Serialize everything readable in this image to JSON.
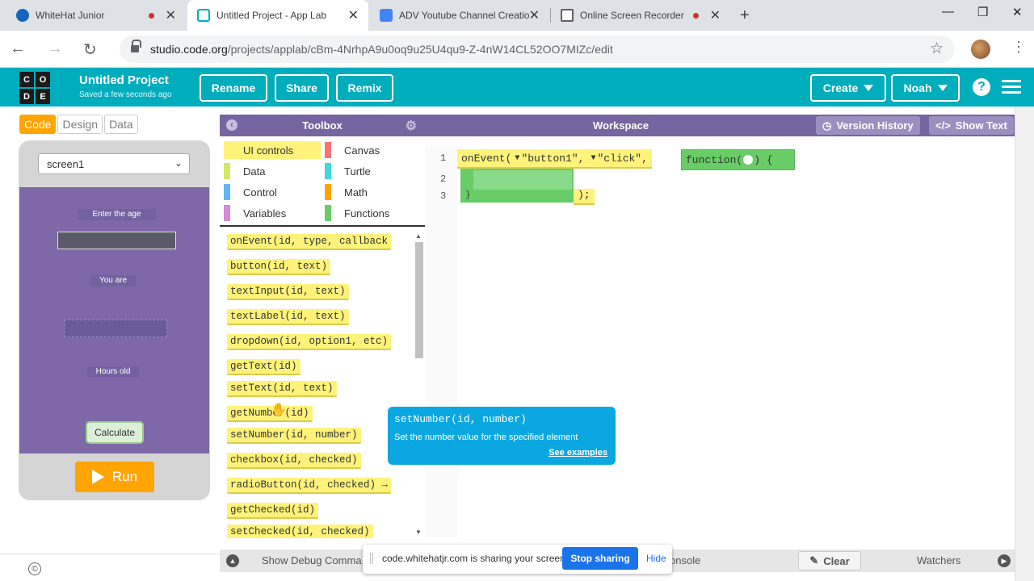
{
  "browser": {
    "tabs": [
      {
        "title": "WhiteHat Junior",
        "recording": true,
        "favicon_color": "#1565c0"
      },
      {
        "title": "Untitled Project - App Lab",
        "recording": false,
        "favicon_color": "#00adbc"
      },
      {
        "title": "ADV Youtube Channel Creatio",
        "recording": false,
        "favicon_color": "#4285f4"
      },
      {
        "title": "Online Screen Recorder",
        "recording": true,
        "favicon_color": "#5f6368"
      }
    ],
    "url_host": "studio.code.org",
    "url_path": "/projects/applab/cBm-4NrhpA9u0oq9u25U4qu9-Z-4nW14CL52OO7MIZc/edit"
  },
  "header": {
    "logo_letters": [
      "C",
      "O",
      "D",
      "E"
    ],
    "project_name": "Untitled Project",
    "save_status": "Saved a few seconds ago",
    "rename": "Rename",
    "share": "Share",
    "remix": "Remix",
    "create": "Create",
    "user": "Noah",
    "help": "?"
  },
  "left": {
    "tabs": {
      "code": "Code",
      "design": "Design",
      "data": "Data"
    },
    "screen_select": "screen1",
    "app": {
      "label_enter_age": "Enter the age",
      "label_you_are": "You are",
      "label_hours_old": "Hours old",
      "calculate": "Calculate"
    },
    "run": "Run",
    "copyright_symbol": "©"
  },
  "toolbox": {
    "title": "Toolbox",
    "categories": [
      {
        "label": "UI controls",
        "color": "#fff27a"
      },
      {
        "label": "Canvas",
        "color": "#f7736f"
      },
      {
        "label": "Data",
        "color": "#d3e965"
      },
      {
        "label": "Turtle",
        "color": "#3fd8dc"
      },
      {
        "label": "Control",
        "color": "#64b5f6"
      },
      {
        "label": "Math",
        "color": "#ffa400"
      },
      {
        "label": "Variables",
        "color": "#d28cd6"
      },
      {
        "label": "Functions",
        "color": "#68cd67"
      }
    ],
    "blocks": [
      "onEvent(id, type, callback",
      "button(id, text)",
      "textInput(id, text)",
      "textLabel(id, text)",
      "dropdown(id, option1, etc)",
      "getText(id)",
      "setText(id, text)",
      "getNumber(id)",
      "setNumber(id, number)",
      "checkbox(id, checked)",
      "radioButton(id, checked) →",
      "getChecked(id)",
      "setChecked(id, checked)"
    ]
  },
  "workspace": {
    "title": "Workspace",
    "version_history": "Version History",
    "show_text": "Show Text",
    "line_numbers": [
      "1",
      "2",
      "3"
    ],
    "code_event": "onEvent(",
    "arg_id": "\"button1\"",
    "arg_type": "\"click\"",
    "comma": ",",
    "fn_keyword": "function(",
    "fn_close": ") {",
    "brace_close": "}",
    "closing": ");"
  },
  "tooltip": {
    "signature": "setNumber(id, number)",
    "description": "Set the number value for the specified element",
    "examples": "See examples"
  },
  "debug": {
    "show_debug": "Show Debug Comma",
    "console": "onsole",
    "clear": "Clear",
    "watchers": "Watchers"
  },
  "share_notice": {
    "text": "code.whitehatjr.com is sharing your screen.",
    "stop": "Stop sharing",
    "hide": "Hide"
  }
}
